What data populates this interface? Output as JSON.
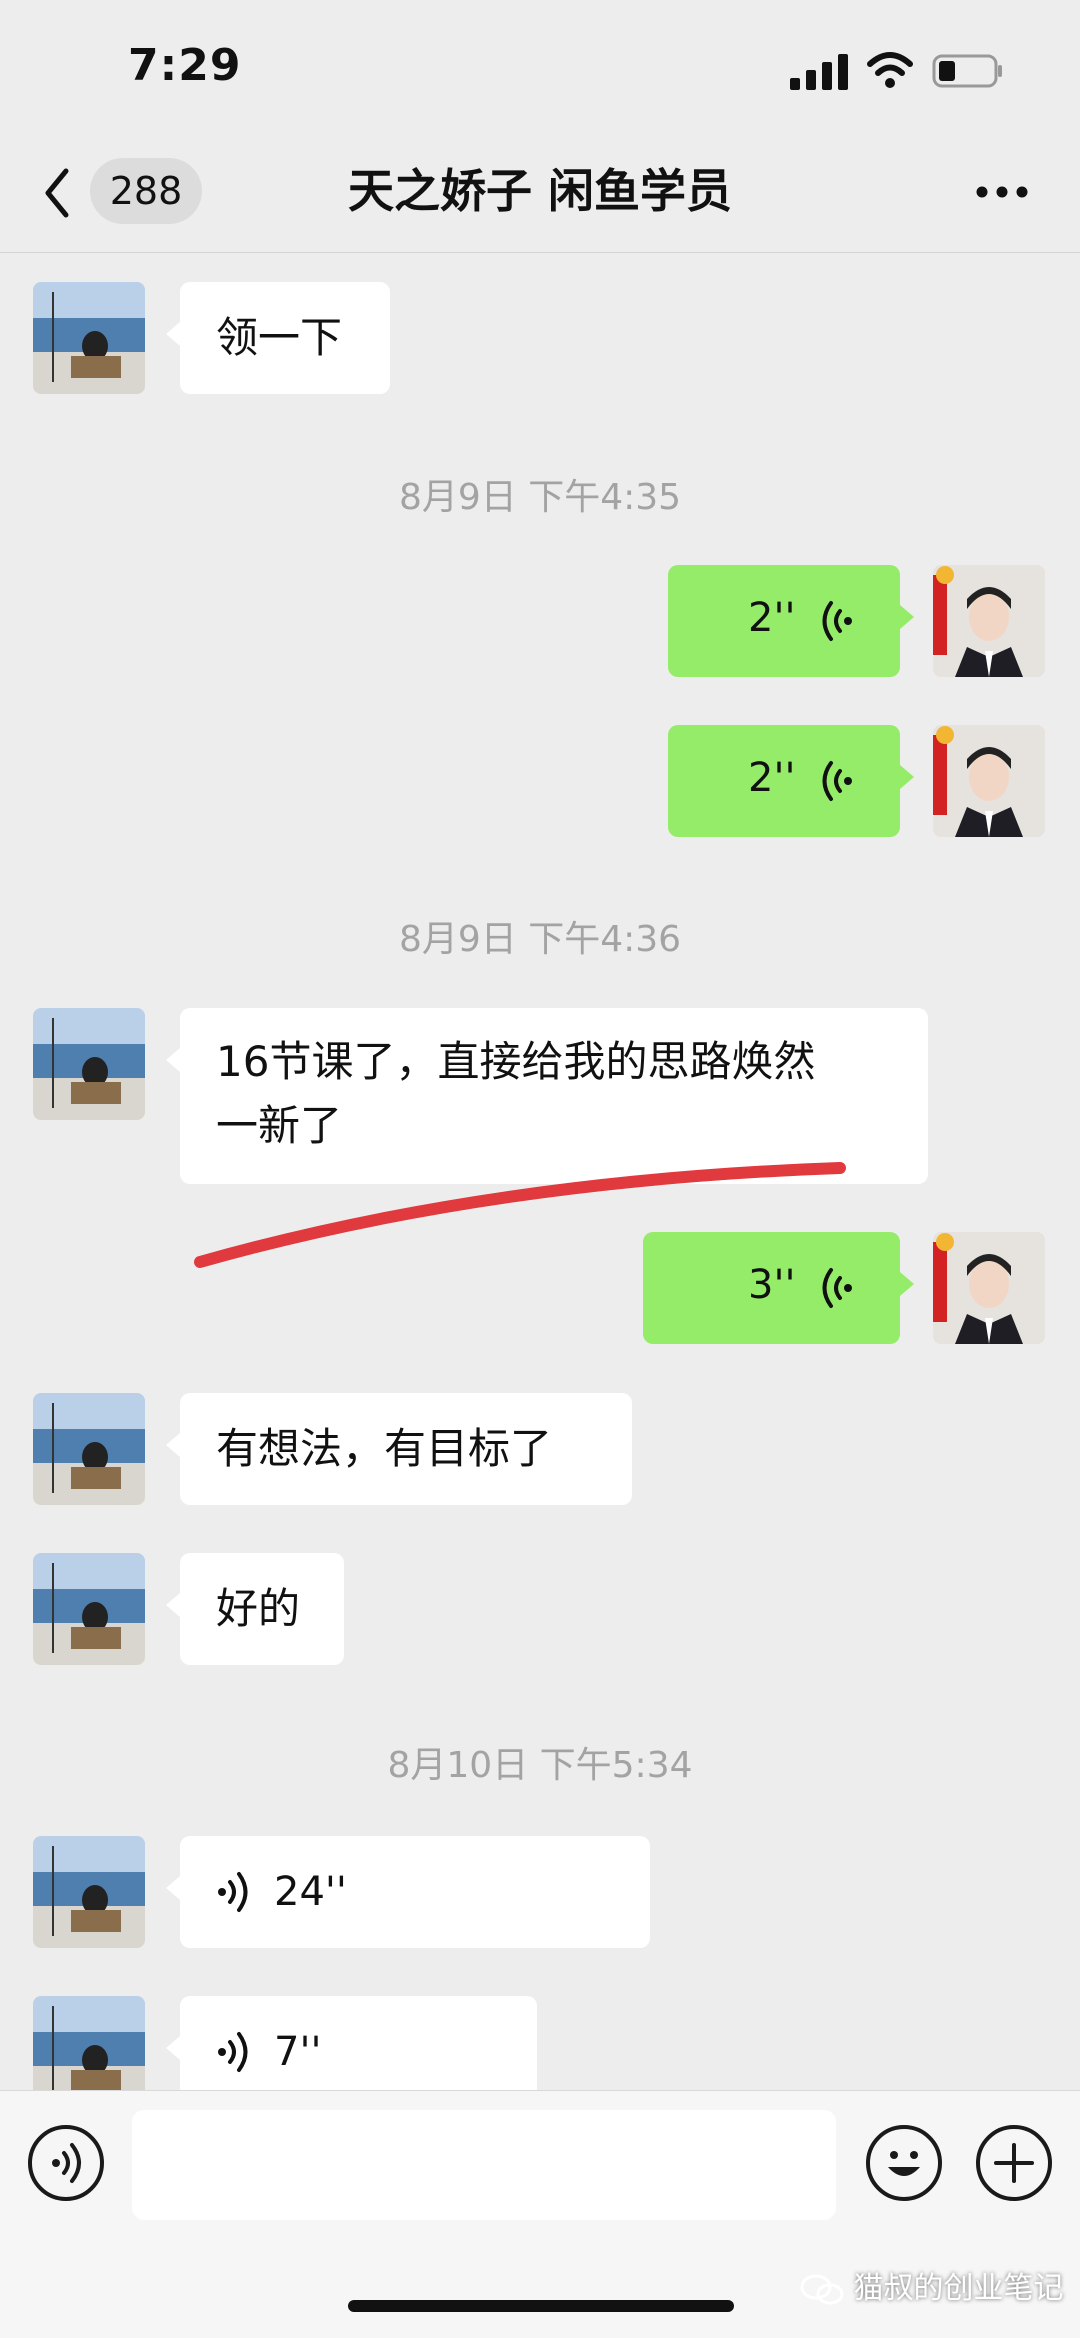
{
  "status_bar": {
    "time": "7:29"
  },
  "header": {
    "unread_count": "288",
    "title": "天之娇子 闲鱼学员"
  },
  "messages": [
    {
      "type": "text",
      "side": "in",
      "text": "领一下"
    },
    {
      "type": "timestamp",
      "text": "8月9日 下午4:35"
    },
    {
      "type": "voice",
      "side": "out",
      "duration": "2''"
    },
    {
      "type": "voice",
      "side": "out",
      "duration": "2''"
    },
    {
      "type": "timestamp",
      "text": "8月9日 下午4:36"
    },
    {
      "type": "text",
      "side": "in",
      "lines": [
        "16节课了，直接给我的思路焕然",
        "一新了"
      ]
    },
    {
      "type": "voice",
      "side": "out",
      "duration": "3''"
    },
    {
      "type": "text",
      "side": "in",
      "text": "有想法，有目标了"
    },
    {
      "type": "text",
      "side": "in",
      "text": "好的"
    },
    {
      "type": "timestamp",
      "text": "8月10日 下午5:34"
    },
    {
      "type": "voice",
      "side": "in",
      "duration": "24''"
    },
    {
      "type": "voice",
      "side": "in",
      "duration": "7''"
    }
  ],
  "watermark": "猫叔的创业笔记",
  "colors": {
    "background": "#ededed",
    "outgoing_bubble": "#95ec69",
    "incoming_bubble": "#ffffff",
    "annotation_stroke": "#e0393e"
  },
  "icons": [
    "back-icon",
    "more-icon",
    "voice-input-icon",
    "emoji-icon",
    "add-icon",
    "voice-wave-icon"
  ]
}
